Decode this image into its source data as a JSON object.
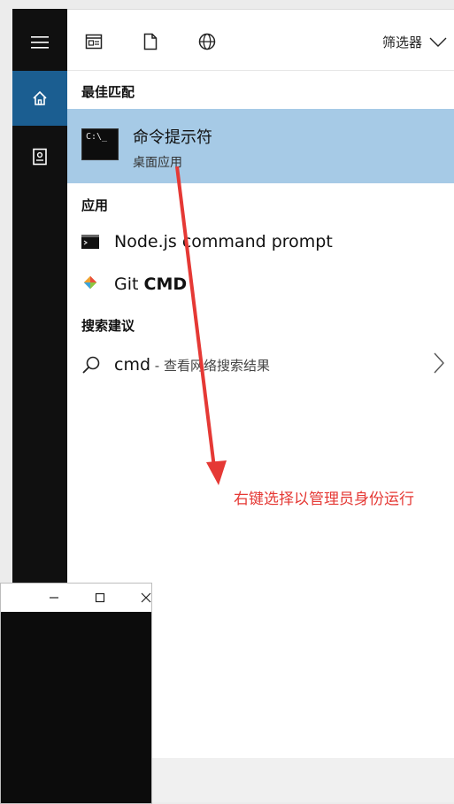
{
  "toolbar": {
    "filter_label": "筛选器"
  },
  "rail": {
    "items": [
      "menu-icon",
      "home-icon",
      "notebook-icon"
    ]
  },
  "sections": {
    "best_match": "最佳匹配",
    "apps": "应用",
    "suggestions": "搜索建议"
  },
  "best_match": {
    "title": "命令提示符",
    "subtitle": "桌面应用",
    "icon_text": "C:\\_"
  },
  "apps": [
    {
      "label": "Node.js command prompt",
      "icon": "console-icon"
    },
    {
      "label_prefix": "Git ",
      "label_bold": "CMD",
      "icon": "git-icon"
    }
  ],
  "suggestion": {
    "query": "cmd",
    "desc": " - 查看网络搜索结果"
  },
  "annotation": "右键选择以管理员身份运行",
  "colors": {
    "accent": "#1b5e91",
    "selected": "#a6cae6",
    "annotation": "#e53935",
    "rail": "#101010"
  }
}
